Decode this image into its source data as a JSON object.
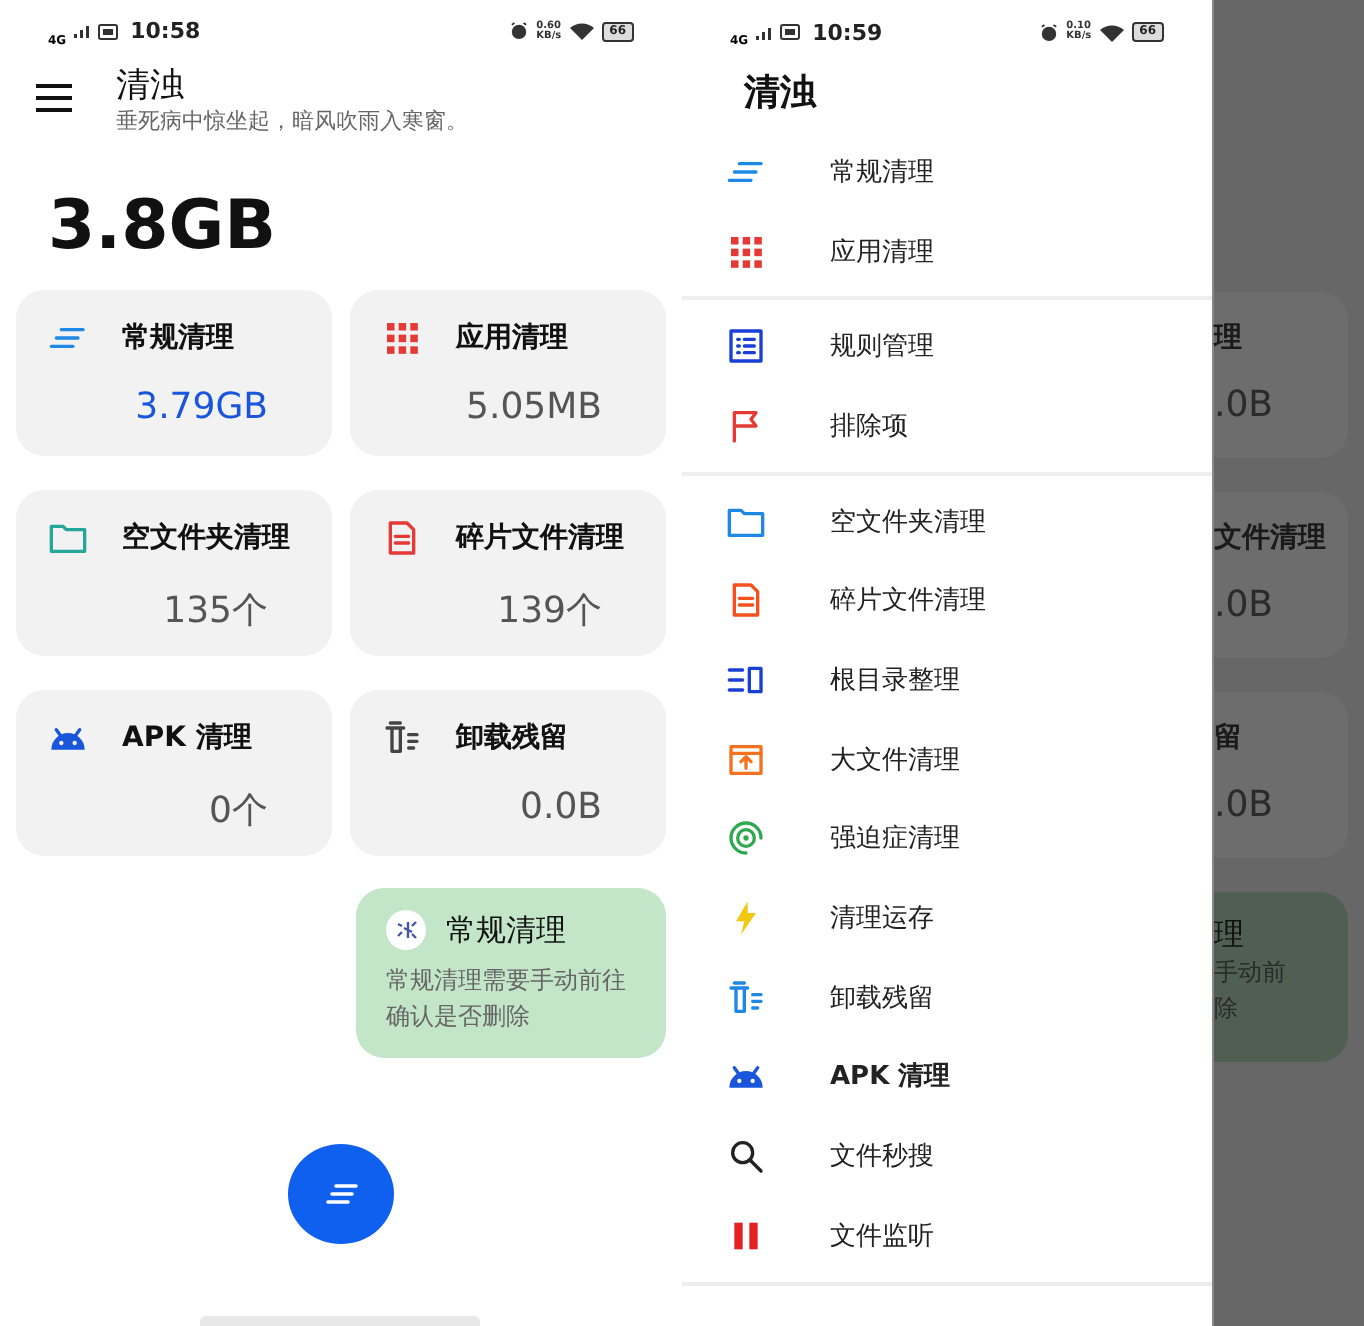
{
  "main_screen": {
    "status_bar": {
      "network": "4G",
      "time": "10:58",
      "speed": "0.60",
      "speed_unit": "KB/s",
      "battery": "66"
    },
    "app_bar": {
      "title": "清浊",
      "subtitle": "垂死病中惊坐起，暗风吹雨入寒窗。"
    },
    "total": "3.8GB",
    "cards": [
      {
        "kind": "lines",
        "color": "#1e88e5",
        "title": "常规清理",
        "value": "3.79GB",
        "highlighted": true
      },
      {
        "kind": "grid",
        "color": "#e53935",
        "title": "应用清理",
        "value": "5.05MB",
        "highlighted": false
      },
      {
        "kind": "folder",
        "color": "#26a69a",
        "title": "空文件夹清理",
        "value": "135个",
        "highlighted": false
      },
      {
        "kind": "doc",
        "color": "#e53935",
        "title": "碎片文件清理",
        "value": "139个",
        "highlighted": false
      },
      {
        "kind": "android",
        "color": "#1a56db",
        "title": "APK 清理",
        "value": "0个",
        "highlighted": false
      },
      {
        "kind": "trash",
        "color": "#444444",
        "title": "卸载残留",
        "value": "0.0B",
        "highlighted": false
      }
    ],
    "toast": {
      "title": "常规清理",
      "message": "常规清理需要手动前往确认是否删除"
    }
  },
  "drawer_screen": {
    "status_bar": {
      "network": "4G",
      "time": "10:59",
      "speed": "0.10",
      "speed_unit": "KB/s",
      "battery": "66"
    },
    "drawer": {
      "title": "清浊",
      "groups": [
        {
          "items": [
            {
              "kind": "lines",
              "color": "#1e88e5",
              "label": "常规清理"
            },
            {
              "kind": "grid",
              "color": "#e53935",
              "label": "应用清理"
            }
          ]
        },
        {
          "items": [
            {
              "kind": "list",
              "color": "#1a3fd6",
              "label": "规则管理"
            },
            {
              "kind": "flag",
              "color": "#e53935",
              "label": "排除项"
            }
          ]
        },
        {
          "items": [
            {
              "kind": "folder",
              "color": "#1e88e5",
              "label": "空文件夹清理"
            },
            {
              "kind": "doc",
              "color": "#f4511e",
              "label": "碎片文件清理"
            },
            {
              "kind": "rootdir",
              "color": "#1a3fd6",
              "label": "根目录整理"
            },
            {
              "kind": "archive",
              "color": "#f4711e",
              "label": "大文件清理"
            },
            {
              "kind": "target",
              "color": "#2fa84f",
              "label": "强迫症清理"
            },
            {
              "kind": "bolt",
              "color": "#f2c811",
              "label": "清理运存"
            },
            {
              "kind": "trash",
              "color": "#1e88e5",
              "label": "卸载残留"
            },
            {
              "kind": "android",
              "color": "#1a56db",
              "label": "APK 清理"
            },
            {
              "kind": "search",
              "color": "#222222",
              "label": "文件秒搜"
            },
            {
              "kind": "pause",
              "color": "#e52222",
              "label": "文件监听"
            }
          ]
        }
      ]
    },
    "backdrop": {
      "cards": [
        {
          "title": "理",
          "value": ".0B"
        },
        {
          "title": "文件清理",
          "value": ".0B"
        },
        {
          "title": "留",
          "value": ".0B"
        }
      ],
      "toast": {
        "title": "理",
        "message_lines": [
          "手动前",
          "除"
        ]
      }
    }
  }
}
